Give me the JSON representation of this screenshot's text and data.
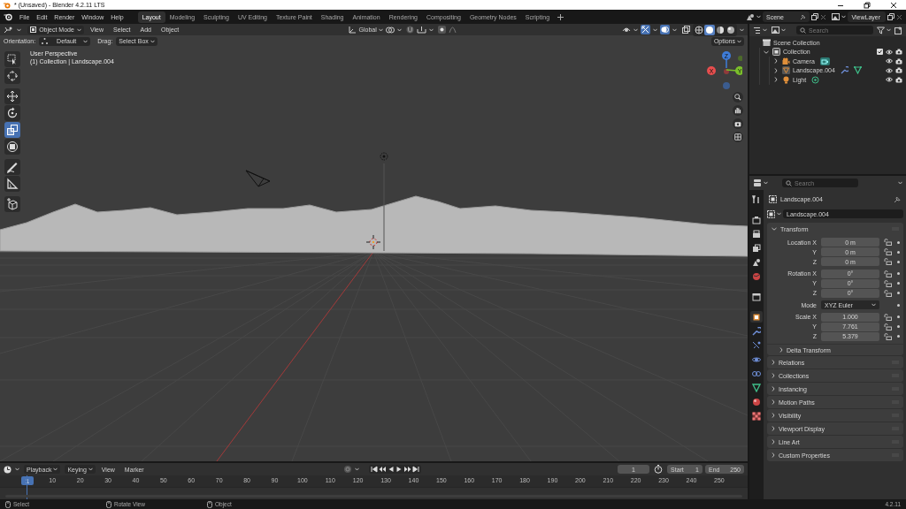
{
  "window": {
    "title": "* (Unsaved) - Blender 4.2.11 LTS"
  },
  "menu": [
    "File",
    "Edit",
    "Render",
    "Window",
    "Help"
  ],
  "workspaces": [
    {
      "label": "Layout",
      "selected": true
    },
    {
      "label": "Modeling",
      "selected": false
    },
    {
      "label": "Sculpting",
      "selected": false
    },
    {
      "label": "UV Editing",
      "selected": false
    },
    {
      "label": "Texture Paint",
      "selected": false
    },
    {
      "label": "Shading",
      "selected": false
    },
    {
      "label": "Animation",
      "selected": false
    },
    {
      "label": "Rendering",
      "selected": false
    },
    {
      "label": "Compositing",
      "selected": false
    },
    {
      "label": "Geometry Nodes",
      "selected": false
    },
    {
      "label": "Scripting",
      "selected": false
    }
  ],
  "scene": {
    "scene": "Scene",
    "view_layer": "ViewLayer"
  },
  "viewport": {
    "mode": "Object Mode",
    "menus": [
      "View",
      "Select",
      "Add",
      "Object"
    ],
    "transform_orientation": "Global",
    "gizmos_on": true,
    "overlays_on": true,
    "shading": [
      {
        "kind": "wireframe",
        "selected": false
      },
      {
        "kind": "solid",
        "selected": true
      },
      {
        "kind": "material",
        "selected": false
      },
      {
        "kind": "rendered",
        "selected": false
      }
    ],
    "orientation_label": "Orientation:",
    "orientation": "Default",
    "drag_label": "Drag:",
    "drag": "Select Box",
    "options": "Options",
    "view_name": "User Perspective",
    "view_info": "(1) Collection | Landscape.004",
    "tools": [
      {
        "kind": "select",
        "selected": false
      },
      {
        "kind": "cursor",
        "selected": false
      },
      {
        "kind": "move",
        "selected": false
      },
      {
        "kind": "rotate",
        "selected": false
      },
      {
        "kind": "scale",
        "selected": true
      },
      {
        "kind": "transform",
        "selected": false
      },
      {
        "kind": "annotate",
        "selected": false
      },
      {
        "kind": "measure",
        "selected": false
      },
      {
        "kind": "add-cube",
        "selected": false
      }
    ],
    "axes": [
      "X",
      "Y",
      "Z"
    ]
  },
  "outliner": {
    "search_placeholder": "Search",
    "tree": [
      {
        "label": "Scene Collection",
        "kind": "scene-collection",
        "children": [
          {
            "label": "Collection",
            "kind": "collection",
            "expanded": true,
            "checked": true,
            "children": [
              {
                "label": "Camera",
                "kind": "camera",
                "expanded": false
              },
              {
                "label": "Landscape.004",
                "kind": "mesh",
                "expanded": false
              },
              {
                "label": "Light",
                "kind": "light",
                "expanded": false
              }
            ]
          }
        ]
      }
    ]
  },
  "properties": {
    "search_placeholder": "Search",
    "object_name": "Landscape.004",
    "datablock": "Landscape.004",
    "tabs": [
      {
        "kind": "tool",
        "selected": false
      },
      {
        "kind": "render",
        "selected": false
      },
      {
        "kind": "output",
        "selected": false
      },
      {
        "kind": "view-layer",
        "selected": false
      },
      {
        "kind": "scene",
        "selected": false
      },
      {
        "kind": "world",
        "selected": false
      },
      {
        "kind": "collection",
        "selected": false
      },
      {
        "kind": "object",
        "selected": true
      },
      {
        "kind": "modifiers",
        "selected": false
      },
      {
        "kind": "particles",
        "selected": false
      },
      {
        "kind": "physics",
        "selected": false
      },
      {
        "kind": "constraints",
        "selected": false
      },
      {
        "kind": "data",
        "selected": false
      },
      {
        "kind": "material",
        "selected": false
      },
      {
        "kind": "texture",
        "selected": false
      }
    ],
    "transform": {
      "title": "Transform",
      "expanded": true,
      "groups": [
        [
          {
            "label": "Location X",
            "value": "0 m",
            "kind": "number"
          },
          {
            "label": "Y",
            "value": "0 m",
            "kind": "number"
          },
          {
            "label": "Z",
            "value": "0 m",
            "kind": "number"
          }
        ],
        [
          {
            "label": "Rotation X",
            "value": "0°",
            "kind": "number"
          },
          {
            "label": "Y",
            "value": "0°",
            "kind": "number"
          },
          {
            "label": "Z",
            "value": "0°",
            "kind": "number"
          }
        ],
        [
          {
            "label": "Mode",
            "value": "XYZ Euler",
            "kind": "dropdown"
          }
        ],
        [
          {
            "label": "Scale X",
            "value": "1.000",
            "kind": "number"
          },
          {
            "label": "Y",
            "value": "7.761",
            "kind": "number"
          },
          {
            "label": "Z",
            "value": "5.379",
            "kind": "number"
          }
        ]
      ],
      "subpanels": [
        {
          "title": "Delta Transform",
          "expanded": false
        }
      ]
    },
    "panels": [
      {
        "title": "Relations",
        "expanded": false
      },
      {
        "title": "Collections",
        "expanded": false
      },
      {
        "title": "Instancing",
        "expanded": false
      },
      {
        "title": "Motion Paths",
        "expanded": false
      },
      {
        "title": "Visibility",
        "expanded": false
      },
      {
        "title": "Viewport Display",
        "expanded": false
      },
      {
        "title": "Line Art",
        "expanded": false
      },
      {
        "title": "Custom Properties",
        "expanded": false
      }
    ]
  },
  "timeline": {
    "menus": [
      {
        "label": "Playback",
        "kind": "dropdown"
      },
      {
        "label": "Keying",
        "kind": "dropdown"
      },
      {
        "label": "View",
        "kind": "menu"
      },
      {
        "label": "Marker",
        "kind": "menu"
      }
    ],
    "current_frame": "1",
    "start_label": "Start",
    "start": "1",
    "end_label": "End",
    "end": "250",
    "playhead": "1",
    "ticks": [
      "10",
      "20",
      "30",
      "40",
      "50",
      "60",
      "70",
      "80",
      "90",
      "100",
      "110",
      "120",
      "130",
      "140",
      "150",
      "160",
      "170",
      "180",
      "190",
      "200",
      "210",
      "220",
      "230",
      "240",
      "250"
    ]
  },
  "status_bar": {
    "hints": [
      "Select",
      "Rotate View",
      "Object"
    ],
    "version": "4.2.11"
  }
}
